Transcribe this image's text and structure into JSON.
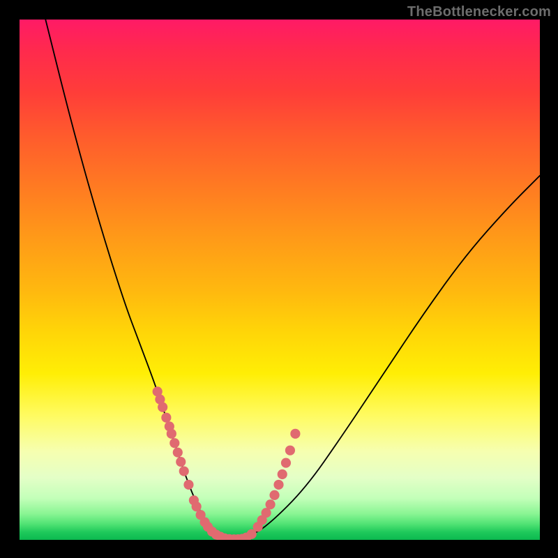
{
  "source_label": "TheBottlenecker.com",
  "chart_data": {
    "type": "line",
    "title": "",
    "xlabel": "",
    "ylabel": "",
    "xlim": [
      0,
      100
    ],
    "ylim": [
      0,
      100
    ],
    "series": [
      {
        "name": "curve",
        "x": [
          5,
          10,
          15,
          20,
          23,
          26,
          28,
          30,
          32,
          34,
          36,
          38,
          40,
          44,
          48,
          55,
          62,
          70,
          78,
          86,
          94,
          100
        ],
        "y": [
          100,
          80,
          62,
          46,
          38,
          30,
          24,
          18,
          12,
          7,
          3,
          1,
          0,
          0.5,
          3,
          10,
          20,
          32,
          44,
          55,
          64,
          70
        ]
      }
    ],
    "markers": {
      "name": "highlight-dots",
      "color": "#e06a70",
      "points_x": [
        26.5,
        27.0,
        27.5,
        28.2,
        28.8,
        29.2,
        29.8,
        30.4,
        31.0,
        31.6,
        32.5,
        33.5,
        34.0,
        34.8,
        35.6,
        36.2,
        37.0,
        37.8,
        38.6,
        39.4,
        40.3,
        41.2,
        42.0,
        42.8,
        43.6,
        44.6,
        45.8,
        46.6,
        47.4,
        48.2,
        49.0,
        49.8,
        50.5,
        51.2,
        52.0,
        53.0
      ],
      "points_y": [
        28.5,
        27.0,
        25.5,
        23.5,
        21.8,
        20.4,
        18.6,
        16.8,
        15.0,
        13.2,
        10.6,
        7.6,
        6.4,
        4.8,
        3.4,
        2.5,
        1.6,
        1.0,
        0.6,
        0.3,
        0.15,
        0.1,
        0.12,
        0.2,
        0.45,
        1.1,
        2.5,
        3.8,
        5.2,
        6.8,
        8.6,
        10.6,
        12.6,
        14.8,
        17.2,
        20.4
      ]
    }
  }
}
